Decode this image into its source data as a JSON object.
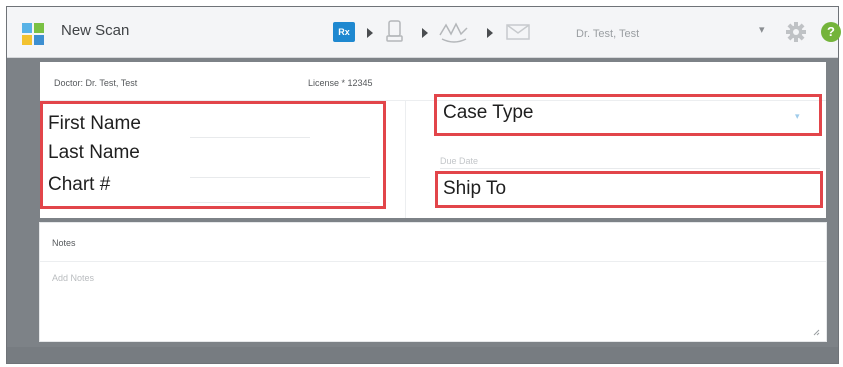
{
  "header": {
    "title": "New Scan",
    "workflow_steps": [
      {
        "icon": "rx-icon",
        "label": "Rx"
      },
      {
        "icon": "scan-icon"
      },
      {
        "icon": "view-icon"
      },
      {
        "icon": "send-icon"
      }
    ],
    "doctor_selected": "Dr. Test, Test",
    "caret": "▾",
    "help": "?"
  },
  "form": {
    "doctor_label": "Doctor:  Dr. Test, Test",
    "license_label": "License *  12345",
    "due_date_label": "Due Date"
  },
  "annotations": {
    "first_name": "First Name",
    "last_name": "Last Name",
    "chart": "Chart #",
    "case_type": "Case Type",
    "ship_to": "Ship To"
  },
  "notes": {
    "label": "Notes",
    "placeholder": "Add Notes"
  },
  "colors": {
    "accent": "#1e88d0",
    "help": "#74b43a",
    "highlight_box": "#e2454a",
    "background": "#7d8287"
  }
}
